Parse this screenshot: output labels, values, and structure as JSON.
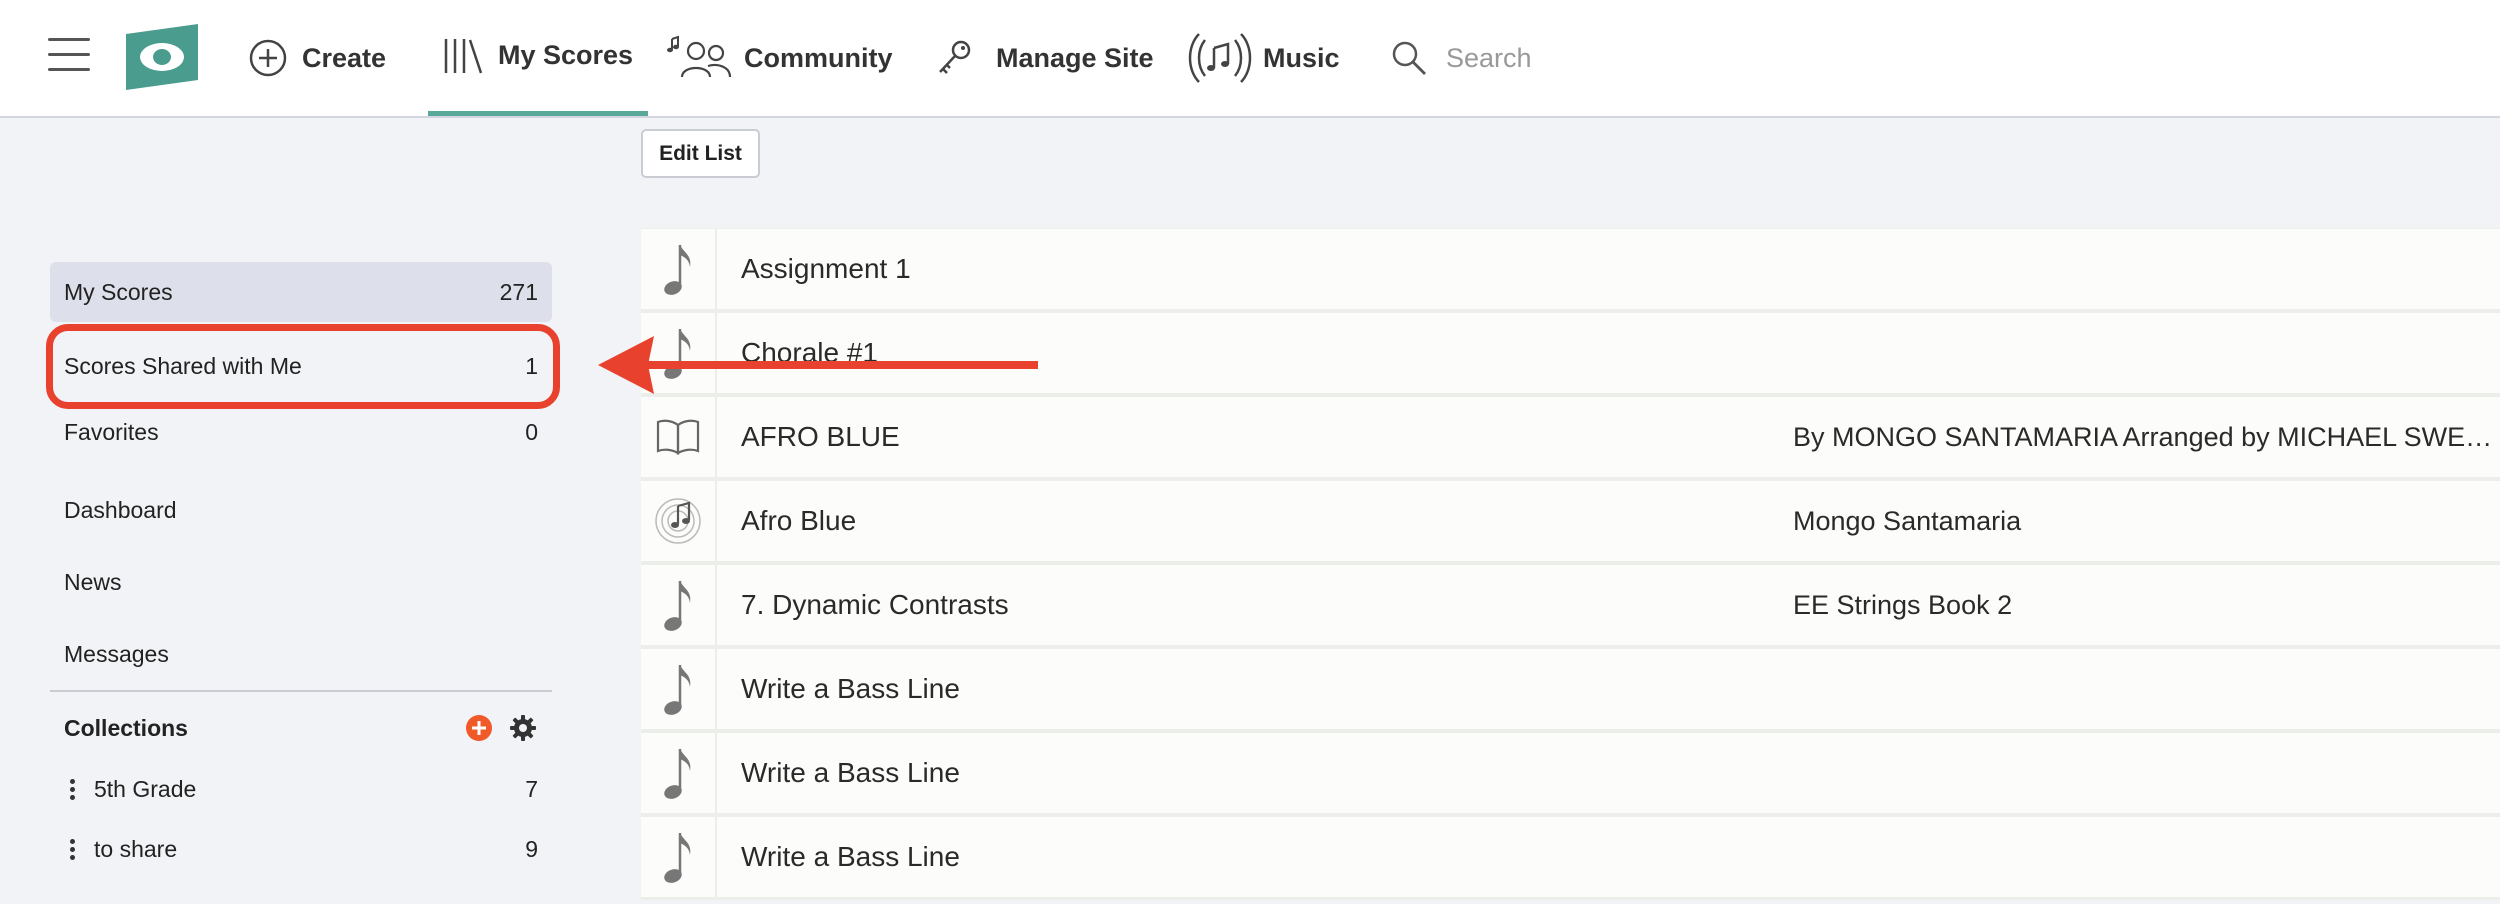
{
  "colors": {
    "accent": "#5aa89a",
    "logo": "#4a9c8e",
    "annotation": "#e8412d",
    "add_icon": "#f05a28"
  },
  "header": {
    "nav": [
      {
        "label": "Create",
        "icon": "plus-circle-icon"
      },
      {
        "label": "My Scores",
        "icon": "library-icon",
        "active": true
      },
      {
        "label": "Community",
        "icon": "people-music-icon"
      },
      {
        "label": "Manage Site",
        "icon": "key-icon"
      },
      {
        "label": "Music",
        "icon": "music-radio-icon"
      }
    ],
    "search": {
      "placeholder": "Search",
      "value": ""
    }
  },
  "toolbar": {
    "edit_list_label": "Edit List"
  },
  "sidebar": {
    "items": [
      {
        "label": "My Scores",
        "count": "271",
        "active": true
      },
      {
        "label": "Scores Shared with Me",
        "count": "1",
        "highlighted": true
      },
      {
        "label": "Favorites",
        "count": "0"
      },
      {
        "label": "Dashboard"
      },
      {
        "label": "News"
      },
      {
        "label": "Messages"
      }
    ],
    "collections": {
      "title": "Collections",
      "add_icon": "add-circle-icon",
      "settings_icon": "gear-icon",
      "items": [
        {
          "name": "5th Grade",
          "count": "7"
        },
        {
          "name": "to share",
          "count": "9"
        }
      ]
    }
  },
  "scores": [
    {
      "title": "Assignment 1",
      "author": "",
      "icon": "music-note-icon"
    },
    {
      "title": "Chorale #1",
      "author": "",
      "icon": "music-note-icon"
    },
    {
      "title": "AFRO BLUE",
      "author": "By MONGO SANTAMARIA Arranged by MICHAEL SWEENEY",
      "icon": "book-icon"
    },
    {
      "title": "Afro Blue",
      "author": "Mongo Santamaria",
      "icon": "audio-note-icon"
    },
    {
      "title": "7. Dynamic Contrasts",
      "author": "EE Strings Book 2",
      "icon": "music-note-icon"
    },
    {
      "title": "Write a Bass Line",
      "author": "",
      "icon": "music-note-icon"
    },
    {
      "title": "Write a Bass Line",
      "author": "",
      "icon": "music-note-icon"
    },
    {
      "title": "Write a Bass Line",
      "author": "",
      "icon": "music-note-icon"
    }
  ]
}
